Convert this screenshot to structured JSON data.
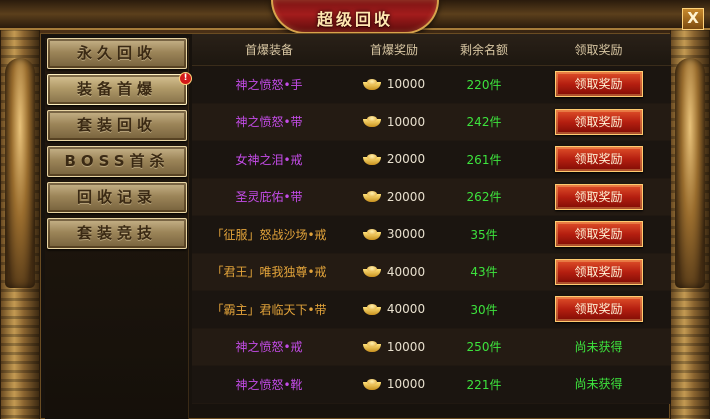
{
  "window": {
    "title": "超级回收",
    "close_label": "X"
  },
  "sidebar": {
    "items": [
      {
        "label": "永久回收",
        "active": false,
        "badge": ""
      },
      {
        "label": "装备首爆",
        "active": true,
        "badge": "!"
      },
      {
        "label": "套装回收",
        "active": false,
        "badge": ""
      },
      {
        "label": "BOSS首杀",
        "active": false,
        "badge": ""
      },
      {
        "label": "回收记录",
        "active": false,
        "badge": ""
      },
      {
        "label": "套装竞技",
        "active": false,
        "badge": ""
      }
    ]
  },
  "table": {
    "headers": [
      "首爆装备",
      "首爆奖励",
      "剩余名额",
      "领取奖励"
    ],
    "rows": [
      {
        "equip": "神之愤怒•手",
        "equip_color": "purple",
        "reward": "10000",
        "remaining": "220件",
        "action": "领取奖励",
        "claimable": true
      },
      {
        "equip": "神之愤怒•带",
        "equip_color": "purple",
        "reward": "10000",
        "remaining": "242件",
        "action": "领取奖励",
        "claimable": true
      },
      {
        "equip": "女神之泪•戒",
        "equip_color": "purple",
        "reward": "20000",
        "remaining": "261件",
        "action": "领取奖励",
        "claimable": true
      },
      {
        "equip": "圣灵庇佑•带",
        "equip_color": "purple",
        "reward": "20000",
        "remaining": "262件",
        "action": "领取奖励",
        "claimable": true
      },
      {
        "equip": "「征服」怒战沙场•戒",
        "equip_color": "orange",
        "reward": "30000",
        "remaining": "35件",
        "action": "领取奖励",
        "claimable": true
      },
      {
        "equip": "「君王」唯我独尊•戒",
        "equip_color": "orange",
        "reward": "40000",
        "remaining": "43件",
        "action": "领取奖励",
        "claimable": true
      },
      {
        "equip": "「霸主」君临天下•带",
        "equip_color": "orange",
        "reward": "40000",
        "remaining": "30件",
        "action": "领取奖励",
        "claimable": true
      },
      {
        "equip": "神之愤怒•戒",
        "equip_color": "purple",
        "reward": "10000",
        "remaining": "250件",
        "action": "尚未获得",
        "claimable": false
      },
      {
        "equip": "神之愤怒•靴",
        "equip_color": "purple",
        "reward": "10000",
        "remaining": "221件",
        "action": "尚未获得",
        "claimable": false
      }
    ]
  },
  "icons": {
    "reward_currency": "gold-ingot-icon"
  }
}
